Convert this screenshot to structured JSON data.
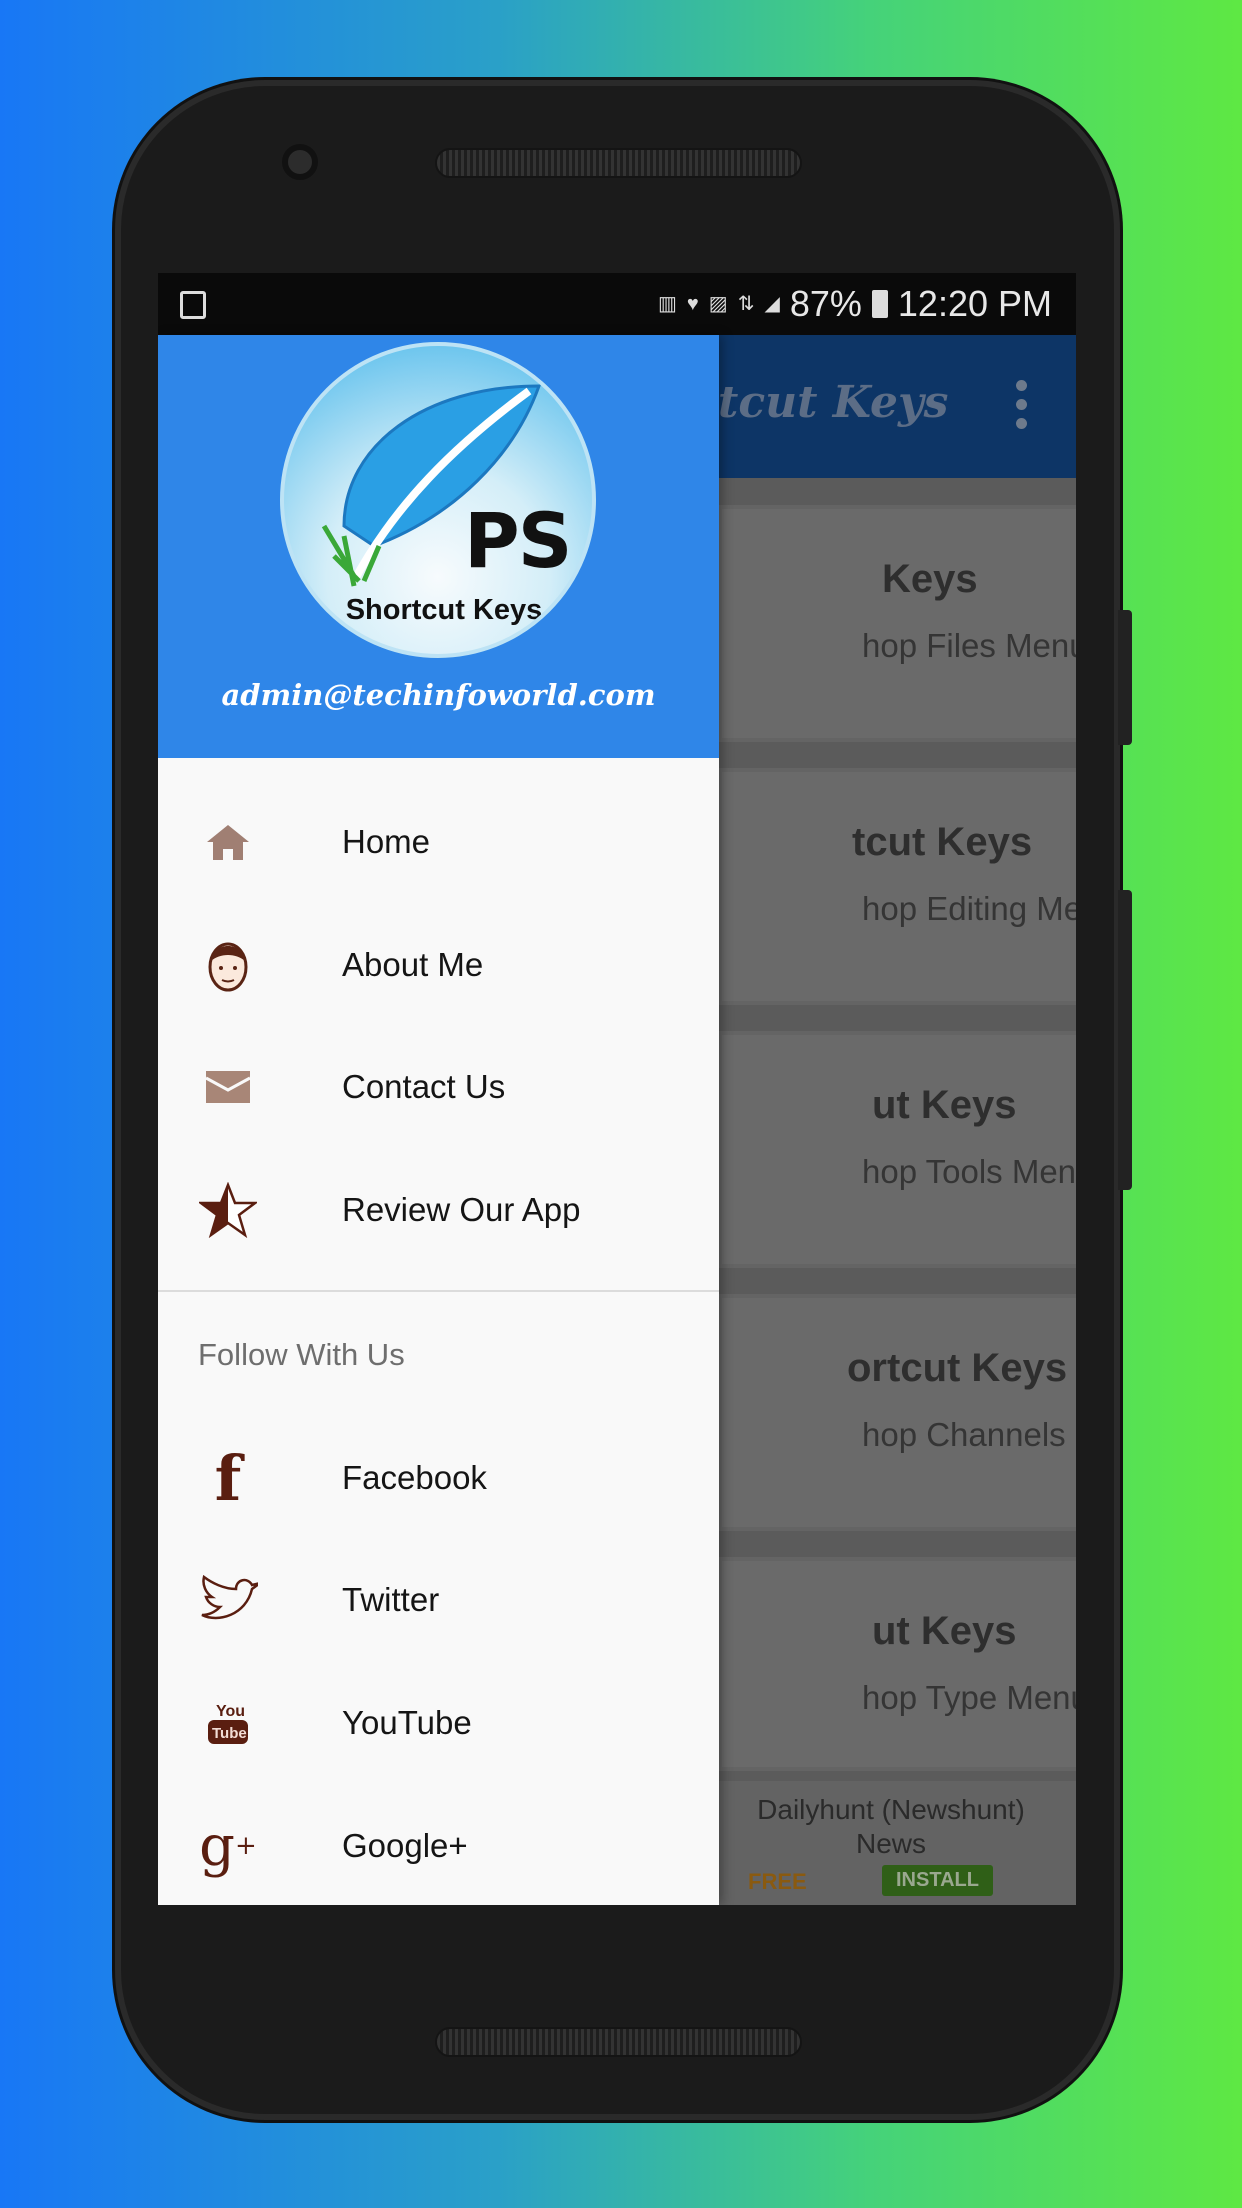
{
  "status_bar": {
    "battery": "87%",
    "time": "12:20 PM",
    "icons": [
      "gallery-icon",
      "volte-icon",
      "notification-icon",
      "data-icon",
      "lte-icon",
      "signal-icon",
      "battery-icon"
    ]
  },
  "app_bar": {
    "title_fragment": "tcut Keys"
  },
  "cards": [
    {
      "title": "Keys",
      "subtitle": "hop Files Menu"
    },
    {
      "title": "tcut Keys",
      "subtitle": "hop Editing Menu"
    },
    {
      "title": "ut Keys",
      "subtitle": "hop Tools Menu"
    },
    {
      "title": "ortcut Keys",
      "subtitle": "hop Channels Menu"
    },
    {
      "title": "ut Keys",
      "subtitle": "hop Type Menu"
    }
  ],
  "ad": {
    "title": "Dailyhunt (Newshunt) News",
    "price": "FREE",
    "install": "INSTALL"
  },
  "drawer": {
    "logo_text": "PS",
    "logo_subtitle": "Shortcut Keys",
    "email": "admin@techinfoworld.com",
    "items": [
      {
        "label": "Home",
        "icon": "home-icon"
      },
      {
        "label": "About Me",
        "icon": "face-icon"
      },
      {
        "label": "Contact Us",
        "icon": "envelope-icon"
      },
      {
        "label": "Review Our App",
        "icon": "star-icon"
      }
    ],
    "section_title": "Follow With Us",
    "social": [
      {
        "label": "Facebook",
        "icon": "facebook-icon"
      },
      {
        "label": "Twitter",
        "icon": "twitter-icon"
      },
      {
        "label": "YouTube",
        "icon": "youtube-icon"
      },
      {
        "label": "Google+",
        "icon": "google-plus-icon"
      }
    ],
    "icon_color": "#6b2a14",
    "header_color": "#2f86e8"
  }
}
